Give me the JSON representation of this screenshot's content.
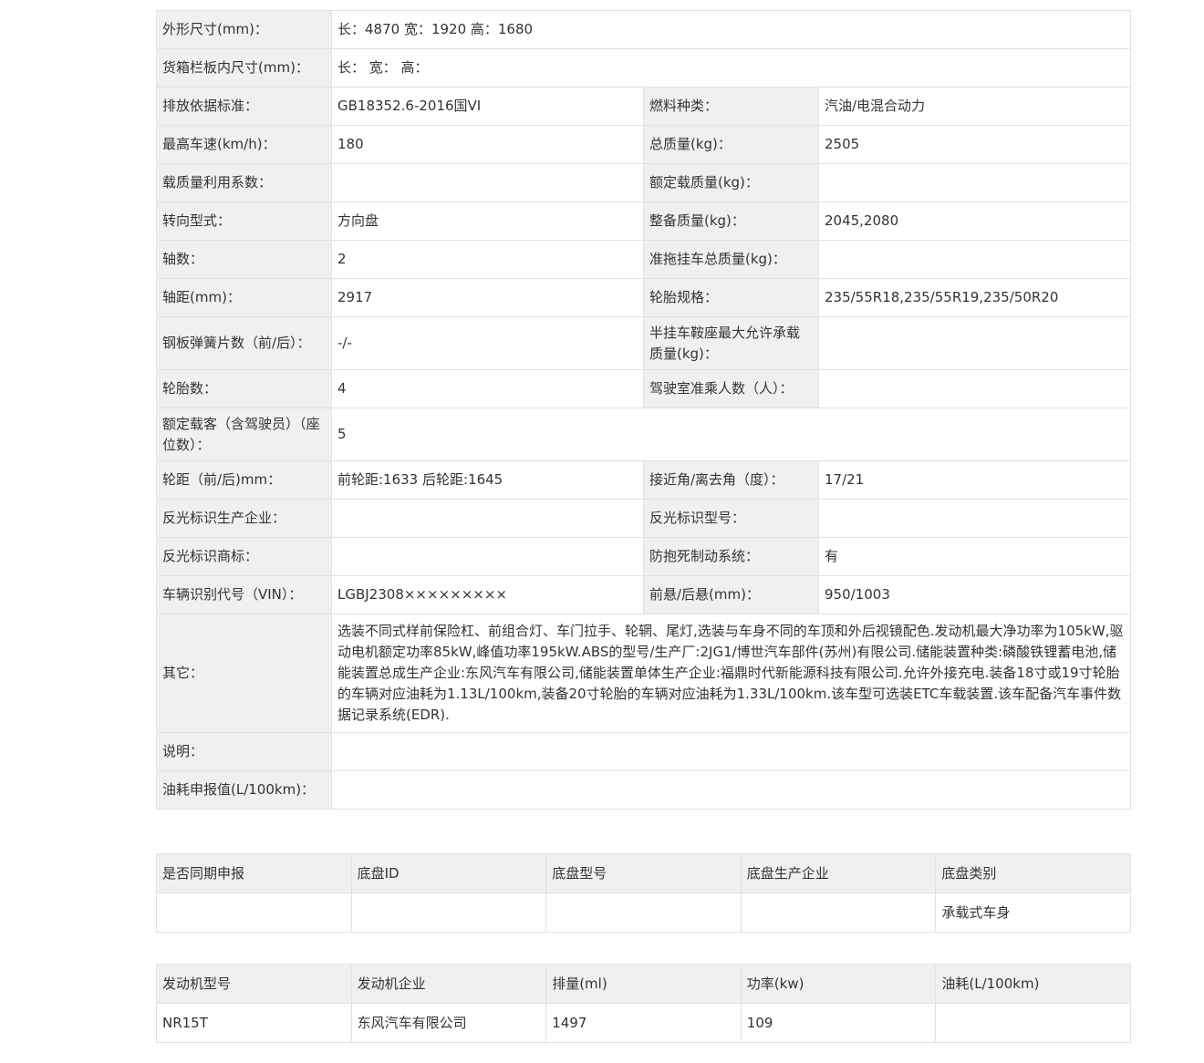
{
  "spec": {
    "dimensions": {
      "label": "外形尺寸(mm)：",
      "value": "长：4870 宽：1920 高：1680"
    },
    "cargo_box": {
      "label": "货箱栏板内尺寸(mm)：",
      "value": "长： 宽： 高："
    },
    "rows": [
      {
        "l1": "排放依据标准：",
        "v1": "GB18352.6-2016国VI",
        "l2": "燃料种类：",
        "v2": "汽油/电混合动力"
      },
      {
        "l1": "最高车速(km/h)：",
        "v1": "180",
        "l2": "总质量(kg)：",
        "v2": "2505"
      },
      {
        "l1": "载质量利用系数：",
        "v1": "",
        "l2": "额定载质量(kg)：",
        "v2": ""
      },
      {
        "l1": "转向型式：",
        "v1": "方向盘",
        "l2": "整备质量(kg)：",
        "v2": "2045,2080"
      },
      {
        "l1": "轴数：",
        "v1": "2",
        "l2": "准拖挂车总质量(kg)：",
        "v2": ""
      },
      {
        "l1": "轴距(mm)：",
        "v1": "2917",
        "l2": "轮胎规格：",
        "v2": "235/55R18,235/55R19,235/50R20"
      },
      {
        "l1": "钢板弹簧片数（前/后）：",
        "v1": "-/-",
        "l2": "半挂车鞍座最大允许承载质量(kg)：",
        "v2": ""
      },
      {
        "l1": "轮胎数：",
        "v1": "4",
        "l2": "驾驶室准乘人数（人）：",
        "v2": ""
      }
    ],
    "passengers": {
      "label": "额定载客（含驾驶员）（座位数）：",
      "value": "5"
    },
    "rows2": [
      {
        "l1": "轮距（前/后)mm：",
        "v1": "前轮距:1633 后轮距:1645",
        "l2": "接近角/离去角（度）：",
        "v2": "17/21"
      },
      {
        "l1": "反光标识生产企业：",
        "v1": "",
        "l2": "反光标识型号：",
        "v2": ""
      },
      {
        "l1": "反光标识商标：",
        "v1": "",
        "l2": "防抱死制动系统：",
        "v2": "有"
      },
      {
        "l1": "车辆识别代号（VIN）：",
        "v1": "LGBJ2308×××××××××",
        "l2": "前悬/后悬(mm)：",
        "v2": "950/1003"
      }
    ],
    "other": {
      "label": "其它：",
      "value": "选装不同式样前保险杠、前组合灯、车门拉手、轮辋、尾灯,选装与车身不同的车顶和外后视镜配色.发动机最大净功率为105kW,驱动电机额定功率85kW,峰值功率195kW.ABS的型号/生产厂:2JG1/博世汽车部件(苏州)有限公司.储能装置种类:磷酸铁锂蓄电池,储能装置总成生产企业:东风汽车有限公司,储能装置单体生产企业:福鼎时代新能源科技有限公司.允许外接充电.装备18寸或19寸轮胎的车辆对应油耗为1.13L/100km,装备20寸轮胎的车辆对应油耗为1.33L/100km.该车型可选装ETC车载装置.该车配备汽车事件数据记录系统(EDR)."
    },
    "note": {
      "label": "说明：",
      "value": ""
    },
    "fuel_declared": {
      "label": "油耗申报值(L/100km)：",
      "value": ""
    }
  },
  "chassis": {
    "headers": [
      "是否同期申报",
      "底盘ID",
      "底盘型号",
      "底盘生产企业",
      "底盘类别"
    ],
    "row": [
      "",
      "",
      "",
      "",
      "承载式车身"
    ]
  },
  "engine": {
    "headers": [
      "发动机型号",
      "发动机企业",
      "排量(ml)",
      "功率(kw)",
      "油耗(L/100km)"
    ],
    "row": [
      "NR15T",
      "东风汽车有限公司",
      "1497",
      "109",
      ""
    ]
  }
}
